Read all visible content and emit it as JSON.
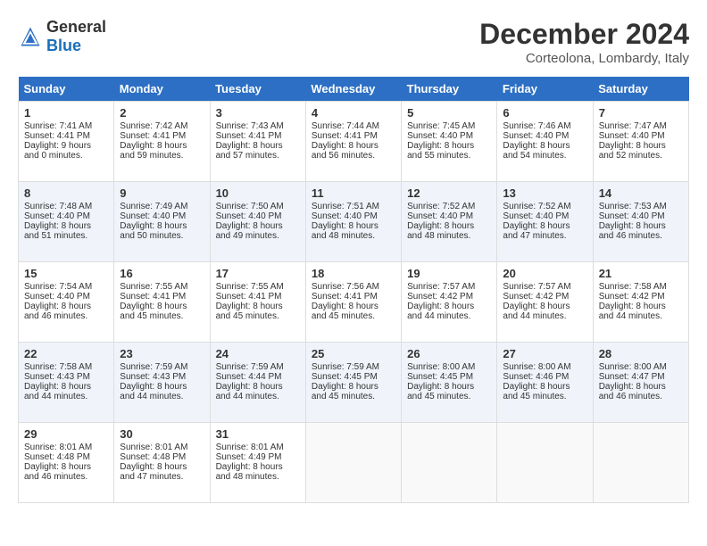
{
  "header": {
    "logo_general": "General",
    "logo_blue": "Blue",
    "month": "December 2024",
    "location": "Corteolona, Lombardy, Italy"
  },
  "days_of_week": [
    "Sunday",
    "Monday",
    "Tuesday",
    "Wednesday",
    "Thursday",
    "Friday",
    "Saturday"
  ],
  "weeks": [
    [
      {
        "day": "1",
        "sunrise": "Sunrise: 7:41 AM",
        "sunset": "Sunset: 4:41 PM",
        "daylight": "Daylight: 9 hours and 0 minutes."
      },
      {
        "day": "2",
        "sunrise": "Sunrise: 7:42 AM",
        "sunset": "Sunset: 4:41 PM",
        "daylight": "Daylight: 8 hours and 59 minutes."
      },
      {
        "day": "3",
        "sunrise": "Sunrise: 7:43 AM",
        "sunset": "Sunset: 4:41 PM",
        "daylight": "Daylight: 8 hours and 57 minutes."
      },
      {
        "day": "4",
        "sunrise": "Sunrise: 7:44 AM",
        "sunset": "Sunset: 4:41 PM",
        "daylight": "Daylight: 8 hours and 56 minutes."
      },
      {
        "day": "5",
        "sunrise": "Sunrise: 7:45 AM",
        "sunset": "Sunset: 4:40 PM",
        "daylight": "Daylight: 8 hours and 55 minutes."
      },
      {
        "day": "6",
        "sunrise": "Sunrise: 7:46 AM",
        "sunset": "Sunset: 4:40 PM",
        "daylight": "Daylight: 8 hours and 54 minutes."
      },
      {
        "day": "7",
        "sunrise": "Sunrise: 7:47 AM",
        "sunset": "Sunset: 4:40 PM",
        "daylight": "Daylight: 8 hours and 52 minutes."
      }
    ],
    [
      {
        "day": "8",
        "sunrise": "Sunrise: 7:48 AM",
        "sunset": "Sunset: 4:40 PM",
        "daylight": "Daylight: 8 hours and 51 minutes."
      },
      {
        "day": "9",
        "sunrise": "Sunrise: 7:49 AM",
        "sunset": "Sunset: 4:40 PM",
        "daylight": "Daylight: 8 hours and 50 minutes."
      },
      {
        "day": "10",
        "sunrise": "Sunrise: 7:50 AM",
        "sunset": "Sunset: 4:40 PM",
        "daylight": "Daylight: 8 hours and 49 minutes."
      },
      {
        "day": "11",
        "sunrise": "Sunrise: 7:51 AM",
        "sunset": "Sunset: 4:40 PM",
        "daylight": "Daylight: 8 hours and 48 minutes."
      },
      {
        "day": "12",
        "sunrise": "Sunrise: 7:52 AM",
        "sunset": "Sunset: 4:40 PM",
        "daylight": "Daylight: 8 hours and 48 minutes."
      },
      {
        "day": "13",
        "sunrise": "Sunrise: 7:52 AM",
        "sunset": "Sunset: 4:40 PM",
        "daylight": "Daylight: 8 hours and 47 minutes."
      },
      {
        "day": "14",
        "sunrise": "Sunrise: 7:53 AM",
        "sunset": "Sunset: 4:40 PM",
        "daylight": "Daylight: 8 hours and 46 minutes."
      }
    ],
    [
      {
        "day": "15",
        "sunrise": "Sunrise: 7:54 AM",
        "sunset": "Sunset: 4:40 PM",
        "daylight": "Daylight: 8 hours and 46 minutes."
      },
      {
        "day": "16",
        "sunrise": "Sunrise: 7:55 AM",
        "sunset": "Sunset: 4:41 PM",
        "daylight": "Daylight: 8 hours and 45 minutes."
      },
      {
        "day": "17",
        "sunrise": "Sunrise: 7:55 AM",
        "sunset": "Sunset: 4:41 PM",
        "daylight": "Daylight: 8 hours and 45 minutes."
      },
      {
        "day": "18",
        "sunrise": "Sunrise: 7:56 AM",
        "sunset": "Sunset: 4:41 PM",
        "daylight": "Daylight: 8 hours and 45 minutes."
      },
      {
        "day": "19",
        "sunrise": "Sunrise: 7:57 AM",
        "sunset": "Sunset: 4:42 PM",
        "daylight": "Daylight: 8 hours and 44 minutes."
      },
      {
        "day": "20",
        "sunrise": "Sunrise: 7:57 AM",
        "sunset": "Sunset: 4:42 PM",
        "daylight": "Daylight: 8 hours and 44 minutes."
      },
      {
        "day": "21",
        "sunrise": "Sunrise: 7:58 AM",
        "sunset": "Sunset: 4:42 PM",
        "daylight": "Daylight: 8 hours and 44 minutes."
      }
    ],
    [
      {
        "day": "22",
        "sunrise": "Sunrise: 7:58 AM",
        "sunset": "Sunset: 4:43 PM",
        "daylight": "Daylight: 8 hours and 44 minutes."
      },
      {
        "day": "23",
        "sunrise": "Sunrise: 7:59 AM",
        "sunset": "Sunset: 4:43 PM",
        "daylight": "Daylight: 8 hours and 44 minutes."
      },
      {
        "day": "24",
        "sunrise": "Sunrise: 7:59 AM",
        "sunset": "Sunset: 4:44 PM",
        "daylight": "Daylight: 8 hours and 44 minutes."
      },
      {
        "day": "25",
        "sunrise": "Sunrise: 7:59 AM",
        "sunset": "Sunset: 4:45 PM",
        "daylight": "Daylight: 8 hours and 45 minutes."
      },
      {
        "day": "26",
        "sunrise": "Sunrise: 8:00 AM",
        "sunset": "Sunset: 4:45 PM",
        "daylight": "Daylight: 8 hours and 45 minutes."
      },
      {
        "day": "27",
        "sunrise": "Sunrise: 8:00 AM",
        "sunset": "Sunset: 4:46 PM",
        "daylight": "Daylight: 8 hours and 45 minutes."
      },
      {
        "day": "28",
        "sunrise": "Sunrise: 8:00 AM",
        "sunset": "Sunset: 4:47 PM",
        "daylight": "Daylight: 8 hours and 46 minutes."
      }
    ],
    [
      {
        "day": "29",
        "sunrise": "Sunrise: 8:01 AM",
        "sunset": "Sunset: 4:48 PM",
        "daylight": "Daylight: 8 hours and 46 minutes."
      },
      {
        "day": "30",
        "sunrise": "Sunrise: 8:01 AM",
        "sunset": "Sunset: 4:48 PM",
        "daylight": "Daylight: 8 hours and 47 minutes."
      },
      {
        "day": "31",
        "sunrise": "Sunrise: 8:01 AM",
        "sunset": "Sunset: 4:49 PM",
        "daylight": "Daylight: 8 hours and 48 minutes."
      },
      null,
      null,
      null,
      null
    ]
  ]
}
